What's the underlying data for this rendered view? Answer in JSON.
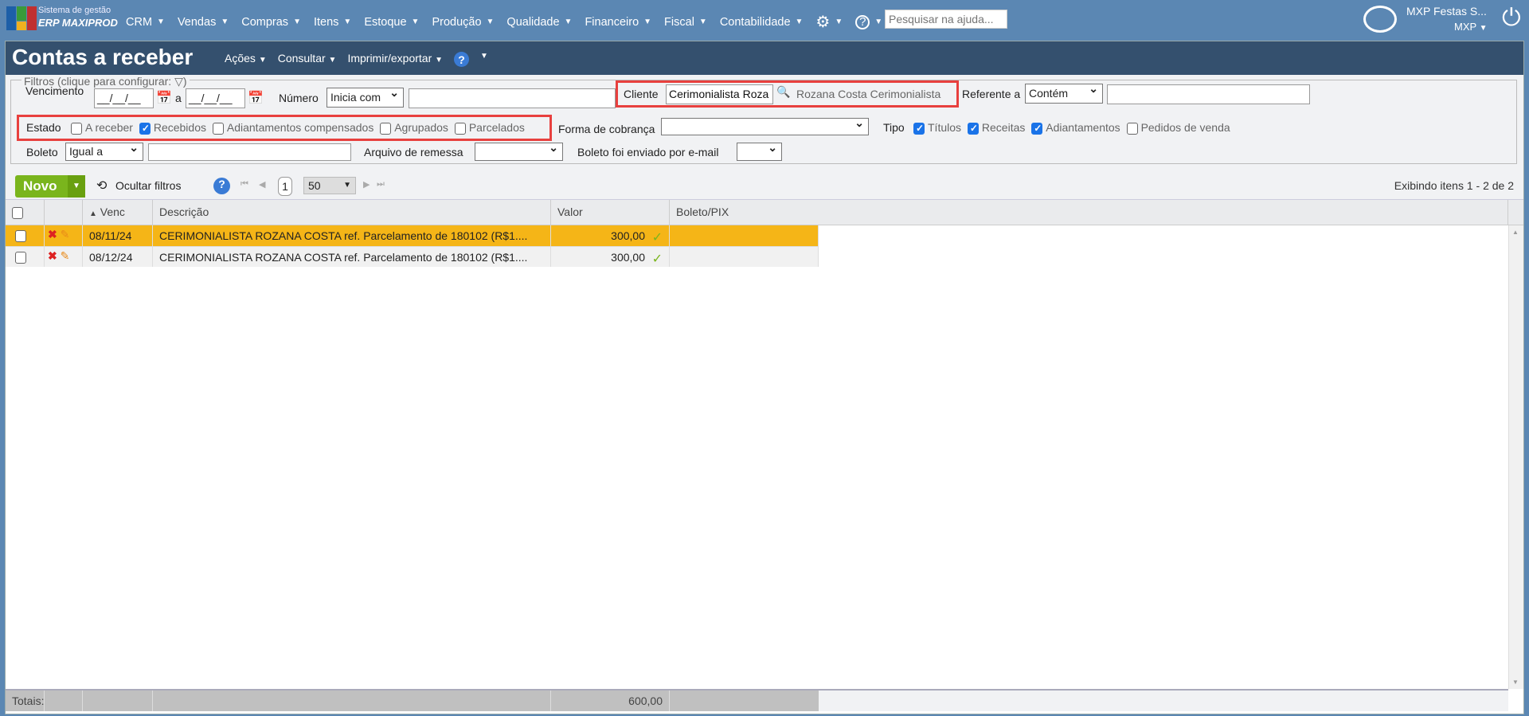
{
  "topbar": {
    "brand_line1": "Sistema de gestão",
    "brand_line2": "ERP MAXIPROD",
    "menu": [
      "CRM",
      "Vendas",
      "Compras",
      "Itens",
      "Estoque",
      "Produção",
      "Qualidade",
      "Financeiro",
      "Fiscal",
      "Contabilidade"
    ],
    "search_placeholder": "Pesquisar na ajuda...",
    "company": "MXP Festas S...",
    "user": "MXP",
    "icons": [
      "gear-icon",
      "help-icon",
      "chat-icon",
      "power-icon"
    ]
  },
  "page": {
    "title": "Contas a receber",
    "menu": [
      "Ações",
      "Consultar",
      "Imprimir/exportar"
    ]
  },
  "filters": {
    "legend": "Filtros (clique para configurar:",
    "vencimento_label": "Vencimento",
    "date_from": "__/__/__",
    "a_label": "a",
    "date_to": "__/__/__",
    "numero_label": "Número",
    "numero_op": "Inicia com",
    "numero_value": "",
    "cliente_label": "Cliente",
    "cliente_value": "Cerimonialista Roza",
    "cliente_result": "Rozana Costa Cerimonialista",
    "referente_label": "Referente a",
    "referente_op": "Contém",
    "referente_value": "",
    "estado_label": "Estado",
    "estado": [
      {
        "label": "A receber",
        "checked": false
      },
      {
        "label": "Recebidos",
        "checked": true
      },
      {
        "label": "Adiantamentos compensados",
        "checked": false
      },
      {
        "label": "Agrupados",
        "checked": false
      },
      {
        "label": "Parcelados",
        "checked": false
      }
    ],
    "forma_label": "Forma de cobrança",
    "forma_value": "",
    "tipo_label": "Tipo",
    "tipo": [
      {
        "label": "Títulos",
        "checked": true
      },
      {
        "label": "Receitas",
        "checked": true
      },
      {
        "label": "Adiantamentos",
        "checked": true
      },
      {
        "label": "Pedidos de venda",
        "checked": false
      }
    ],
    "boleto_label": "Boleto",
    "boleto_op": "Igual a",
    "boleto_value": "",
    "arquivo_label": "Arquivo de remessa",
    "arquivo_value": "",
    "email_label": "Boleto foi enviado por e-mail",
    "email_value": "",
    "highlight_color": "#e8403e"
  },
  "toolbar": {
    "novo": "Novo",
    "hide_filters": "Ocultar filtros",
    "page": "1",
    "page_size": "50",
    "status": "Exibindo itens 1 - 2 de 2"
  },
  "grid": {
    "columns": [
      "Venc",
      "Descrição",
      "Valor",
      "Boleto/PIX"
    ],
    "rows": [
      {
        "venc": "08/11/24",
        "descricao": "CERIMONIALISTA ROZANA COSTA ref. Parcelamento de 180102 (R$1....",
        "valor": "300,00",
        "selected": true
      },
      {
        "venc": "08/12/24",
        "descricao": "CERIMONIALISTA ROZANA COSTA ref. Parcelamento de 180102 (R$1....",
        "valor": "300,00",
        "selected": false
      }
    ],
    "totals_label": "Totais:",
    "totals_valor": "600,00",
    "selected_color": "#f5b517"
  }
}
